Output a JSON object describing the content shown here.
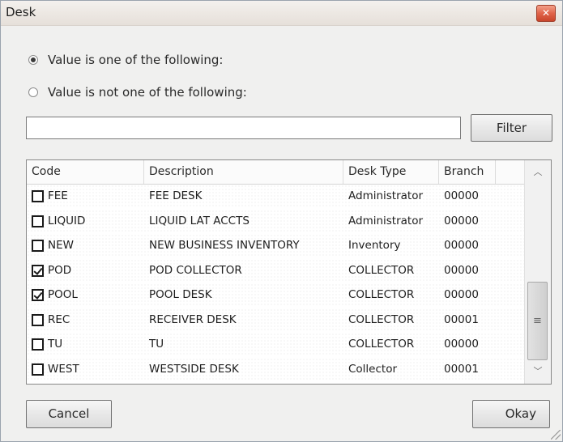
{
  "window": {
    "title": "Desk"
  },
  "options": {
    "radio_one_of": {
      "label": "Value is one of the following:",
      "checked": true
    },
    "radio_not_one_of": {
      "label": "Value is not one of the following:",
      "checked": false
    }
  },
  "filter": {
    "value": "",
    "button_label": "Filter"
  },
  "table": {
    "columns": [
      "Code",
      "Description",
      "Desk Type",
      "Branch"
    ],
    "rows": [
      {
        "checked": false,
        "code": "FEE",
        "description": "FEE DESK",
        "desk_type": "Administrator",
        "branch": "00000"
      },
      {
        "checked": false,
        "code": "LIQUID",
        "description": "LIQUID LAT ACCTS",
        "desk_type": "Administrator",
        "branch": "00000"
      },
      {
        "checked": false,
        "code": "NEW",
        "description": "NEW BUSINESS INVENTORY",
        "desk_type": "Inventory",
        "branch": "00000"
      },
      {
        "checked": true,
        "code": "POD",
        "description": "POD COLLECTOR",
        "desk_type": "COLLECTOR",
        "branch": "00000"
      },
      {
        "checked": true,
        "code": "POOL",
        "description": "POOL DESK",
        "desk_type": "COLLECTOR",
        "branch": "00000"
      },
      {
        "checked": false,
        "code": "REC",
        "description": "RECEIVER DESK",
        "desk_type": "COLLECTOR",
        "branch": "00001"
      },
      {
        "checked": false,
        "code": "TU",
        "description": "TU",
        "desk_type": "COLLECTOR",
        "branch": "00000"
      },
      {
        "checked": false,
        "code": "WEST",
        "description": "WESTSIDE DESK",
        "desk_type": "Collector",
        "branch": "00001"
      }
    ]
  },
  "buttons": {
    "cancel": "Cancel",
    "okay": "Okay"
  },
  "icons": {
    "close": "close-icon",
    "scroll_up": "chevron-up-icon",
    "scroll_down": "chevron-down-icon",
    "thumb_grip": "grip-lines-icon",
    "resize": "resize-grip-icon"
  }
}
